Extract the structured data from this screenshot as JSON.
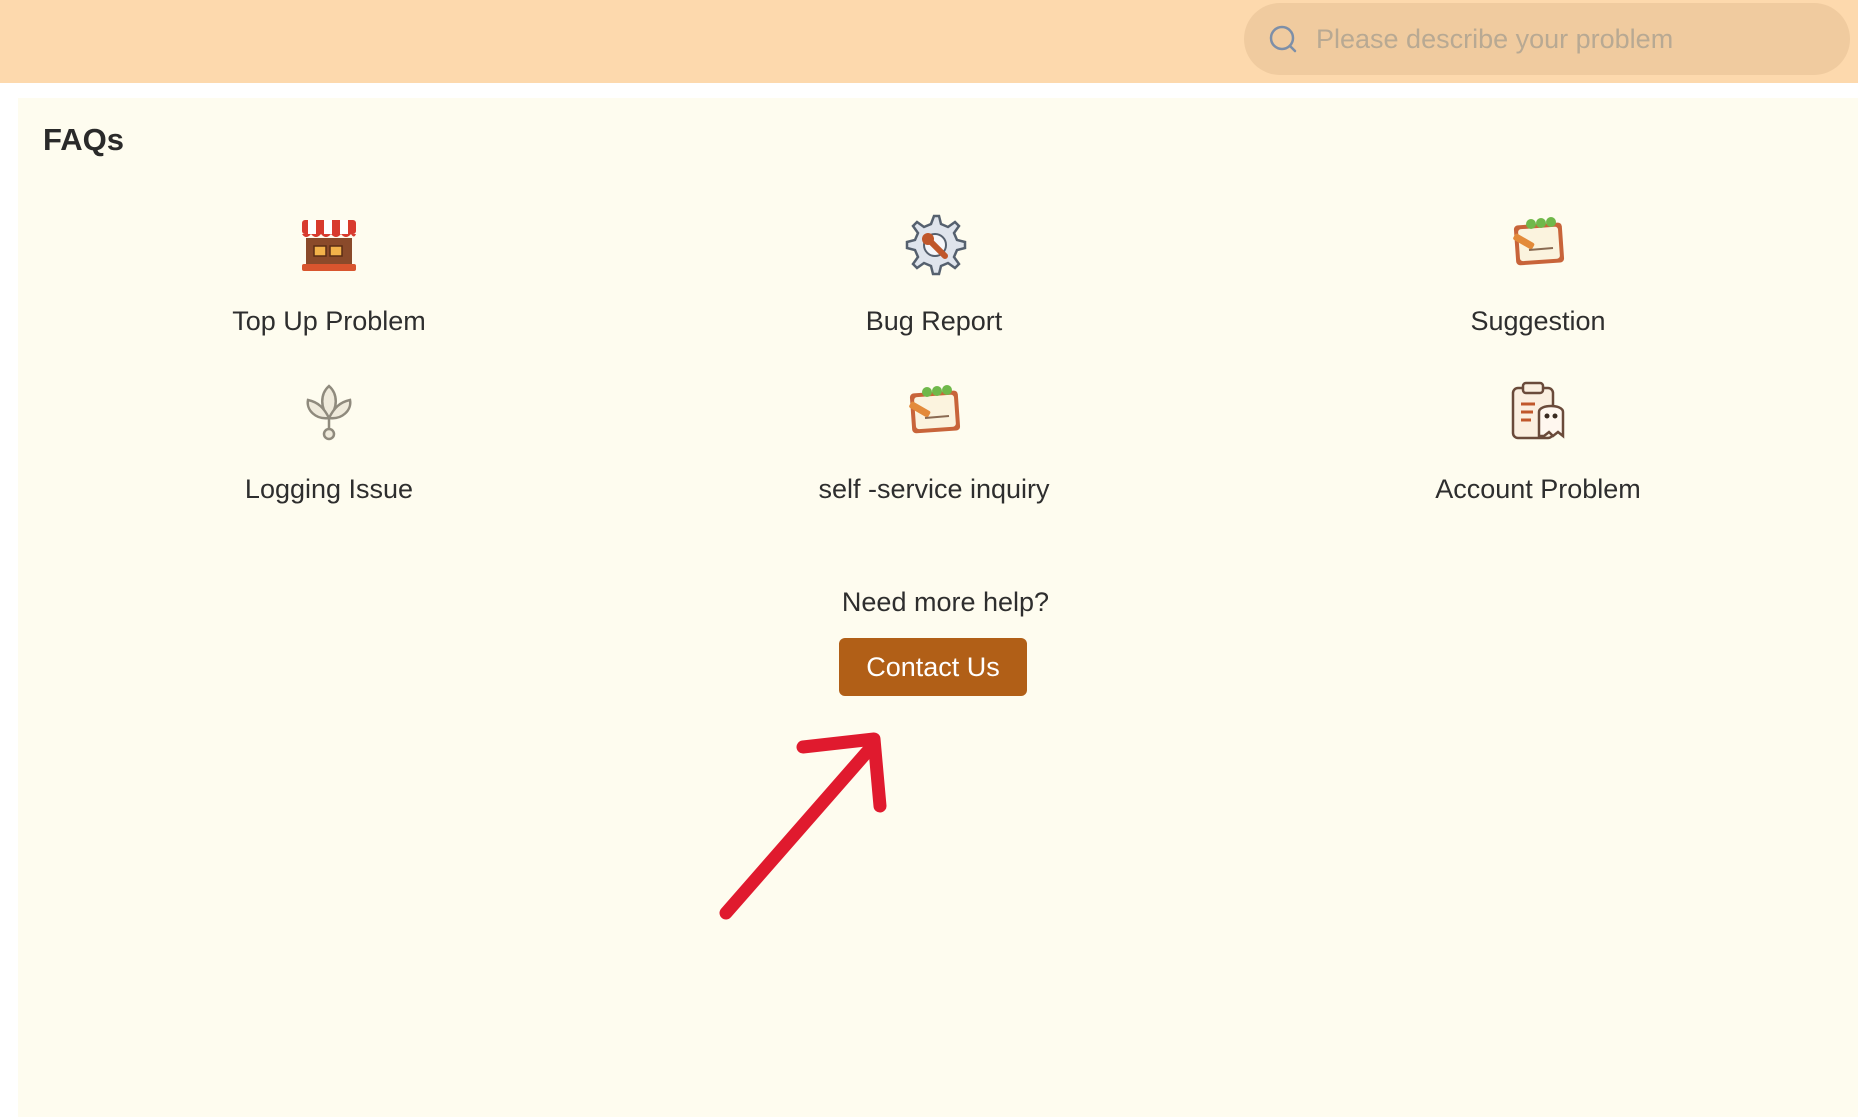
{
  "header": {
    "search": {
      "icon": "search-icon",
      "placeholder": "Please describe your problem"
    }
  },
  "faqs": {
    "title": "FAQs",
    "items": [
      {
        "label": "Top Up Problem",
        "icon": "shop-stall-icon"
      },
      {
        "label": "Bug Report",
        "icon": "gear-wrench-icon"
      },
      {
        "label": "Suggestion",
        "icon": "notepad-pencil-icon"
      },
      {
        "label": "Logging Issue",
        "icon": "login-leaf-icon"
      },
      {
        "label": "self -service inquiry",
        "icon": "notepad-pencil-icon"
      },
      {
        "label": "Account Problem",
        "icon": "clipboard-ghost-icon"
      }
    ]
  },
  "help": {
    "text": "Need more help?",
    "button_label": "Contact Us"
  },
  "annotation": {
    "icon": "red-arrow-icon",
    "color": "#e01a2e"
  },
  "colors": {
    "header_bg": "#fdd9ad",
    "panel_bg": "#fefcef",
    "button_bg": "#b15f17"
  }
}
